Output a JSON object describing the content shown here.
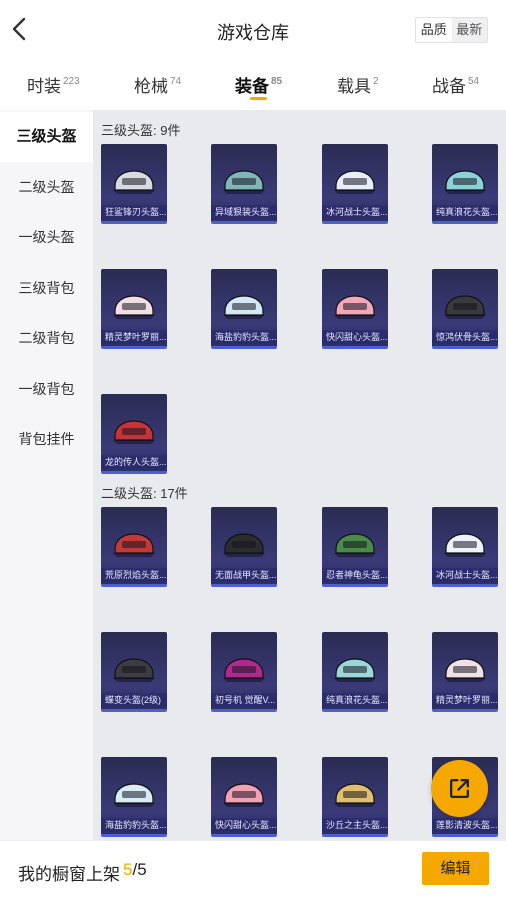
{
  "header": {
    "title": "游戏仓库",
    "sort_quality": "品质",
    "sort_newest": "最新"
  },
  "tabs": [
    {
      "label": "时装",
      "count": "223"
    },
    {
      "label": "枪械",
      "count": "74"
    },
    {
      "label": "装备",
      "count": "85"
    },
    {
      "label": "载具",
      "count": "2"
    },
    {
      "label": "战备",
      "count": "54"
    }
  ],
  "sidebar": {
    "items": [
      {
        "label": "三级头盔"
      },
      {
        "label": "二级头盔"
      },
      {
        "label": "一级头盔"
      },
      {
        "label": "三级背包"
      },
      {
        "label": "二级背包"
      },
      {
        "label": "一级背包"
      },
      {
        "label": "背包挂件"
      }
    ]
  },
  "sections": [
    {
      "title": "三级头盔: 9件",
      "items": [
        {
          "name": "狂鲨锋刃头盔...",
          "color": "#d9d9e0"
        },
        {
          "name": "异域狠装头盔...",
          "color": "#7fb6b8"
        },
        {
          "name": "冰河战士头盔...",
          "color": "#e6eef8"
        },
        {
          "name": "纯真浪花头盔...",
          "color": "#8ad1d8"
        },
        {
          "name": "精灵梦叶罗丽...",
          "color": "#f2dfe6"
        },
        {
          "name": "海盐豹豹头盔...",
          "color": "#d4e9f6"
        },
        {
          "name": "快闪甜心头盔...",
          "color": "#f4a7b8"
        },
        {
          "name": "惊鸿伏骨头盔...",
          "color": "#3a3a3e"
        },
        {
          "name": "龙的传人头盔...",
          "color": "#c8333a"
        }
      ]
    },
    {
      "title": "二级头盔: 17件",
      "items": [
        {
          "name": "荒原烈焰头盔...",
          "color": "#c03a3a"
        },
        {
          "name": "无面战甲头盔...",
          "color": "#2c2c30"
        },
        {
          "name": "忍者神龟头盔...",
          "color": "#4a8a4a"
        },
        {
          "name": "冰河战士头盔...",
          "color": "#eef2fa"
        },
        {
          "name": "蝶变头盔(2级)",
          "color": "#3c3c42"
        },
        {
          "name": "初号机 觉醒V...",
          "color": "#b02a8e"
        },
        {
          "name": "纯真浪花头盔...",
          "color": "#9ad8da"
        },
        {
          "name": "精灵梦叶罗丽...",
          "color": "#f1e1e4"
        },
        {
          "name": "海盐豹豹头盔...",
          "color": "#d8ecf6"
        },
        {
          "name": "快闪甜心头盔...",
          "color": "#f2a0b4"
        },
        {
          "name": "沙丘之主头盔...",
          "color": "#e0c070"
        },
        {
          "name": "莲影清波头盔...",
          "color": "#d0dfe6"
        }
      ]
    }
  ],
  "footer": {
    "shelf_label": "我的橱窗上架",
    "shelf_current": "5",
    "shelf_sep": "/",
    "shelf_total": "5",
    "edit_label": "编辑"
  }
}
